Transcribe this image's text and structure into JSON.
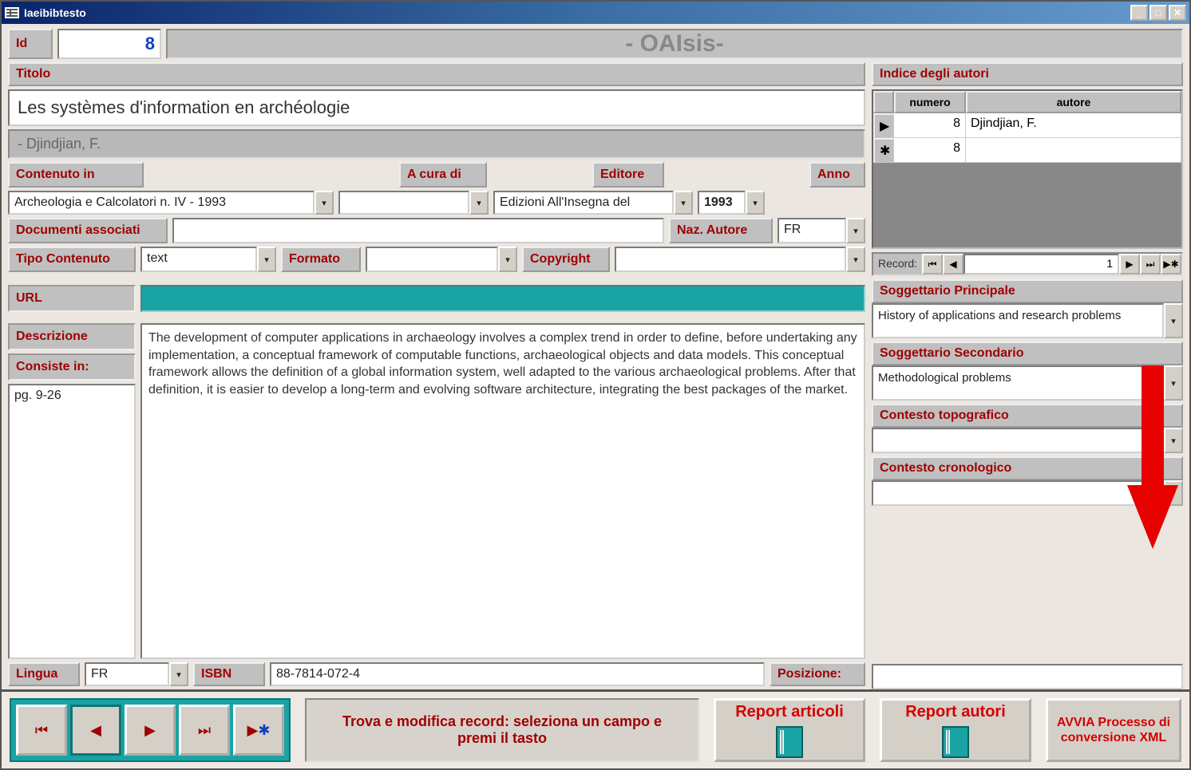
{
  "window": {
    "title": "Iaeibibtesto"
  },
  "header": {
    "id_label": "Id",
    "id_value": "8",
    "app_title": "- OAIsis-"
  },
  "titolo": {
    "label": "Titolo",
    "value": "Les systèmes d'information en archéologie",
    "author_line": "- Djindjian, F."
  },
  "contenuto_in": {
    "label": "Contenuto in",
    "value": "Archeologia e Calcolatori n. IV - 1993"
  },
  "a_cura_di": {
    "label": "A cura di",
    "value": ""
  },
  "editore": {
    "label": "Editore",
    "value": "Edizioni All'Insegna del"
  },
  "anno": {
    "label": "Anno",
    "value": "1993"
  },
  "documenti_associati": {
    "label": "Documenti associati",
    "value": ""
  },
  "naz_autore": {
    "label": "Naz. Autore",
    "value": "FR"
  },
  "tipo_contenuto": {
    "label": "Tipo Contenuto",
    "value": "text"
  },
  "formato": {
    "label": "Formato",
    "value": ""
  },
  "copyright": {
    "label": "Copyright",
    "value": ""
  },
  "url": {
    "label": "URL",
    "value": ""
  },
  "descrizione": {
    "label": "Descrizione",
    "value": "The development of computer applications in archaeology involves a complex trend in order to define, before undertaking any implementation, a conceptual framework of computable functions, archaeological objects and data models. This conceptual framework allows the definition of a global information system, well adapted to the various archaeological problems. After that definition, it is easier to develop a long-term and evolving software architecture, integrating the best packages of the market."
  },
  "consiste_in": {
    "label": "Consiste in:",
    "value": "pg. 9-26"
  },
  "lingua": {
    "label": "Lingua",
    "value": "FR"
  },
  "isbn": {
    "label": "ISBN",
    "value": "88-7814-072-4"
  },
  "posizione": {
    "label": "Posizione:",
    "value": ""
  },
  "indice_autori": {
    "label": "Indice degli autori",
    "col_numero": "numero",
    "col_autore": "autore",
    "rows": [
      {
        "selector": "▶",
        "numero": "8",
        "autore": "Djindjian, F."
      },
      {
        "selector": "✱",
        "numero": "8",
        "autore": ""
      }
    ],
    "record_label": "Record:",
    "record_value": "1"
  },
  "sogg_principale": {
    "label": "Soggettario Principale",
    "value": "History of applications and research problems"
  },
  "sogg_secondario": {
    "label": "Soggettario Secondario",
    "value": "Methodological problems"
  },
  "contesto_topo": {
    "label": "Contesto topografico",
    "value": ""
  },
  "contesto_crono": {
    "label": "Contesto cronologico",
    "value": ""
  },
  "footer": {
    "find_text": "Trova e modifica record: seleziona un campo e premi il tasto",
    "report_articoli": "Report articoli",
    "report_autori": "Report autori",
    "avvia_xml": "AVVIA Processo di conversione XML"
  }
}
